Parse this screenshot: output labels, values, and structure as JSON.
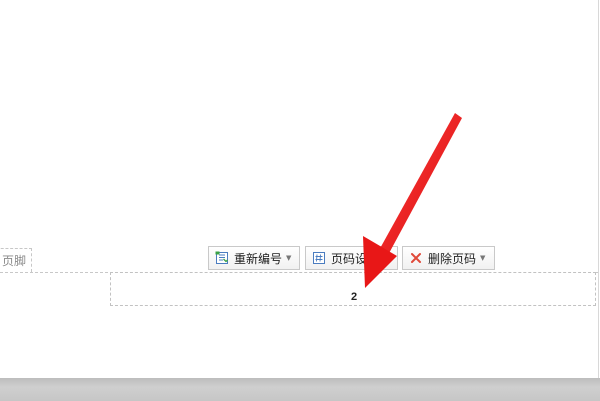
{
  "footer": {
    "tab_label": "页脚",
    "page_number": "2"
  },
  "toolbar": {
    "renumber_label": "重新编号",
    "page_settings_label": "页码设",
    "delete_label": "删除页码"
  },
  "icons": {
    "renumber": "renumber-icon",
    "page_settings": "page-number-settings-icon",
    "delete": "delete-x-icon",
    "caret": "chevron-down-icon"
  },
  "colors": {
    "annotation_arrow": "#ee1c1c",
    "delete_icon": "#e04a3a",
    "icon_blue": "#4a7cc0"
  }
}
